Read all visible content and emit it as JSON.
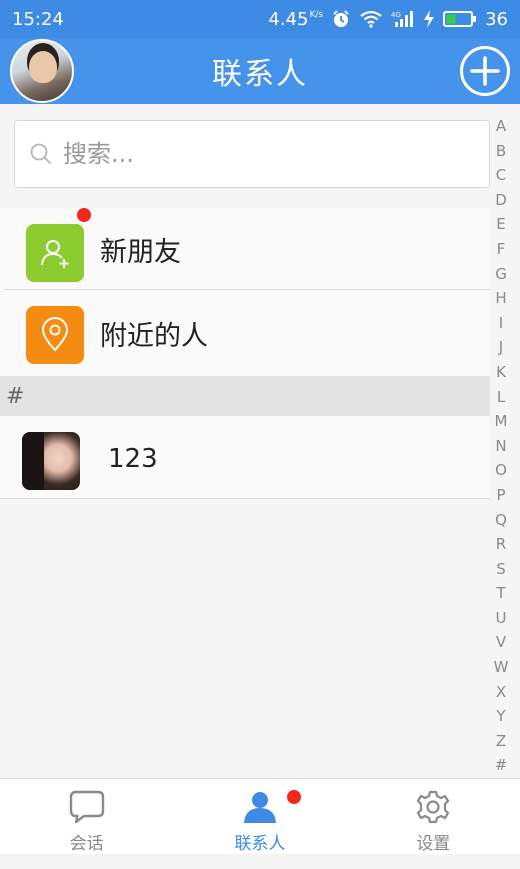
{
  "status_bar": {
    "time": "15:24",
    "network_speed": "4.45",
    "speed_unit": "K/s",
    "battery": "36",
    "icons": [
      "alarm-icon",
      "wifi-icon",
      "signal-4g-icon",
      "charging-icon",
      "battery-icon"
    ]
  },
  "header": {
    "title": "联系人",
    "avatar_icon": "profile-avatar",
    "add_icon": "add-circle-icon"
  },
  "search": {
    "placeholder": "搜索..."
  },
  "functions": [
    {
      "label": "新朋友",
      "icon": "add-friend-icon",
      "color": "#8ccc2f",
      "has_badge": true
    },
    {
      "label": "附近的人",
      "icon": "location-pin-icon",
      "color": "#f58c11",
      "has_badge": false
    }
  ],
  "section": {
    "header": "#"
  },
  "contacts": [
    {
      "name": "123"
    }
  ],
  "alpha_index": [
    "A",
    "B",
    "C",
    "D",
    "E",
    "F",
    "G",
    "H",
    "I",
    "J",
    "K",
    "L",
    "M",
    "N",
    "O",
    "P",
    "Q",
    "R",
    "S",
    "T",
    "U",
    "V",
    "W",
    "X",
    "Y",
    "Z",
    "#"
  ],
  "bottom_nav": [
    {
      "label": "会话",
      "icon": "chat-bubble-icon",
      "active": false
    },
    {
      "label": "联系人",
      "icon": "contacts-person-icon",
      "active": true,
      "has_badge": true
    },
    {
      "label": "设置",
      "icon": "settings-gear-icon",
      "active": false
    }
  ],
  "colors": {
    "primary": "#4593ea",
    "badge_red": "#f5271a",
    "new_friend_green": "#8ccc2f",
    "nearby_orange": "#f58c11"
  }
}
